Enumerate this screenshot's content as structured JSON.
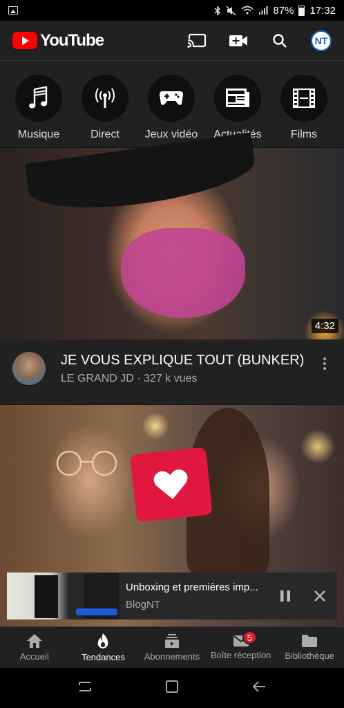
{
  "status_bar": {
    "battery": "87%",
    "time": "17:32"
  },
  "header": {
    "logo_text": "YouTube",
    "avatar_text": "NT",
    "brand_color": "#ff0000"
  },
  "categories": [
    {
      "label": "Musique",
      "icon": "music-note-icon"
    },
    {
      "label": "Direct",
      "icon": "live-broadcast-icon"
    },
    {
      "label": "Jeux vidéo",
      "icon": "gamepad-icon"
    },
    {
      "label": "Actualités",
      "icon": "newspaper-icon"
    },
    {
      "label": "Films",
      "icon": "film-strip-icon"
    }
  ],
  "videos": [
    {
      "title": "JE VOUS EXPLIQUE TOUT (BUNKER)",
      "channel": "LE GRAND JD · 327 k vues",
      "duration": "4:32"
    }
  ],
  "mini_player": {
    "title": "Unboxing et premières imp...",
    "channel": "BlogNT"
  },
  "bottom_nav": [
    {
      "label": "Accueil",
      "icon": "home-icon"
    },
    {
      "label": "Tendances",
      "icon": "flame-icon",
      "active": true
    },
    {
      "label": "Abonnements",
      "icon": "subscriptions-icon"
    },
    {
      "label": "Boîte réception",
      "icon": "mail-icon",
      "badge": "5"
    },
    {
      "label": "Bibliothèque",
      "icon": "folder-icon"
    }
  ]
}
